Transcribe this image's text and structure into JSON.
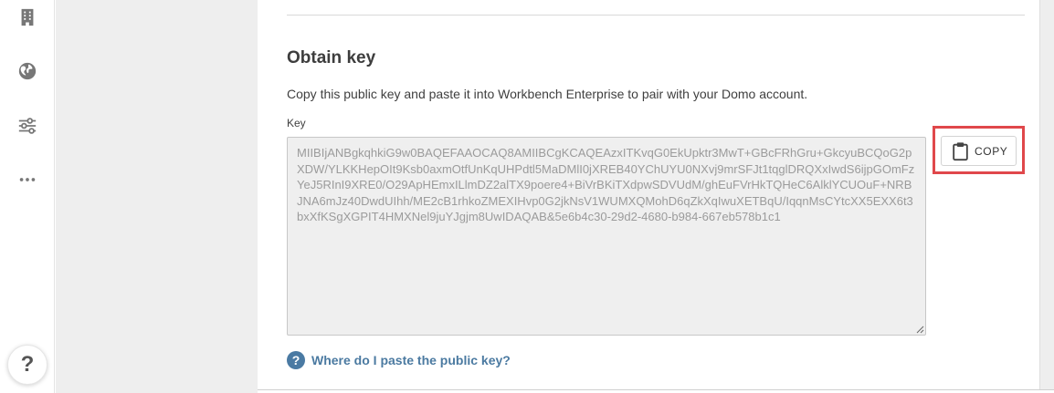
{
  "nav": {
    "items": [
      {
        "icon": "building-icon"
      },
      {
        "icon": "globe-icon"
      },
      {
        "icon": "sliders-icon"
      },
      {
        "icon": "more-icon"
      }
    ],
    "help_label": "?"
  },
  "obtain_key": {
    "title": "Obtain key",
    "description": "Copy this public key and paste it into Workbench Enterprise to pair with your Domo account.",
    "key_label": "Key",
    "key_value": "MIIBIjANBgkqhkiG9w0BAQEFAAOCAQ8AMIIBCgKCAQEAzxITKvqG0EkUpktr3MwT+GBcFRhGru+GkcyuBCQoG2pXDW/YLKKHepOIt9Ksb0axmOtfUnKqUHPdtl5MaDMlI0jXREB40YChUYU0NXvj9mrSFJt1tqglDRQXxIwdS6ijpGOmFzYeJ5RInI9XRE0/O29ApHEmxILlmDZ2alTX9poere4+BiVrBKiTXdpwSDVUdM/ghEuFVrHkTQHeC6AlklYCUOuF+NRBJNA6mJz40DwdUIhh/ME2cB1rhkoZMEXIHvp0G2jkNsV1WUMXQMohD6qZkXqIwuXETBqU/IqqnMsCYtcXX5EXX6t3bxXfKSgXGPIT4HMXNel9juYJgjm8UwIDAQAB&5e6b4c30-29d2-4680-b984-667eb578b1c1",
    "copy_label": "COPY",
    "help_link": "Where do I paste the public key?",
    "help_icon_glyph": "?"
  },
  "colors": {
    "highlight": "#e0484b",
    "link": "#4b7aa1"
  }
}
